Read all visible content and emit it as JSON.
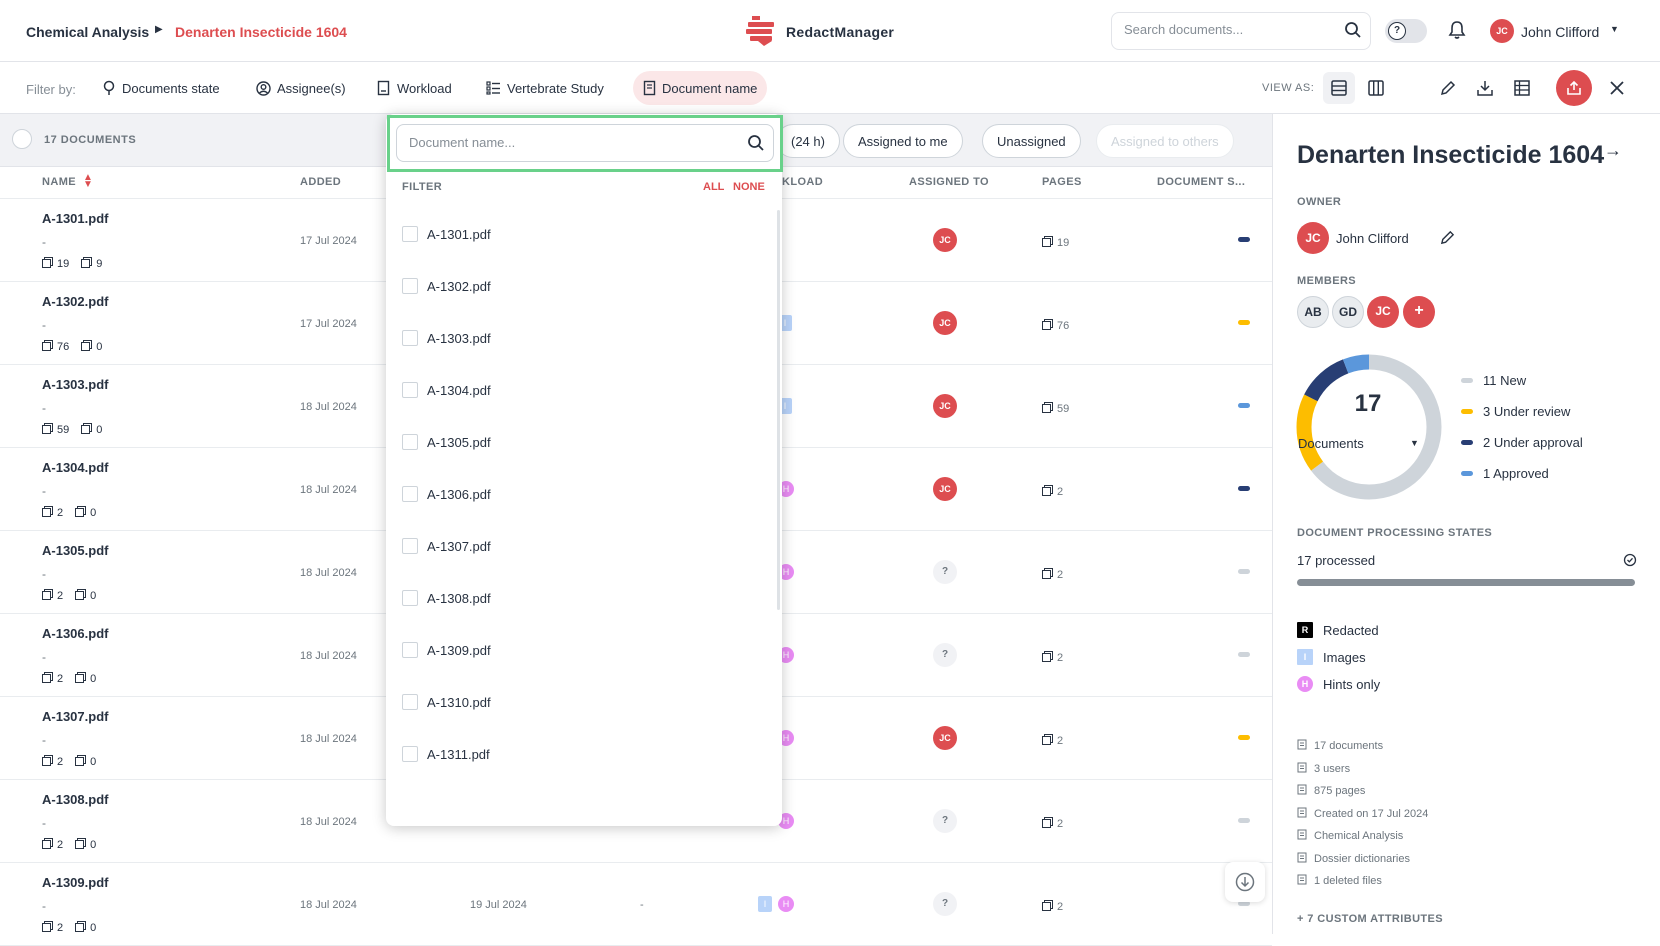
{
  "header": {
    "breadcrumb_root": "Chemical Analysis",
    "breadcrumb_current": "Denarten Insecticide 1604",
    "app_name": "RedactManager",
    "search_placeholder": "Search documents...",
    "help_label": "?",
    "user_initials": "JC",
    "user_name": "John Clifford"
  },
  "filters": {
    "label": "Filter by:",
    "items": [
      "Documents state",
      "Assignee(s)",
      "Workload",
      "Vertebrate Study",
      "Document name"
    ],
    "view_as": "VIEW AS:"
  },
  "table": {
    "count_label": "17 DOCUMENTS",
    "quick_filters": [
      "(24 h)",
      "Assigned to me",
      "Unassigned",
      "Assigned to others"
    ],
    "columns": [
      "NAME",
      "ADDED",
      "KLOAD",
      "ASSIGNED TO",
      "PAGES",
      "DOCUMENT S..."
    ],
    "rows": [
      {
        "name": "A-1301.pdf",
        "dash": "-",
        "pages_meta": "19",
        "annot_meta": "9",
        "added": "17 Jul 2024",
        "assignee": "JC",
        "pages": "19",
        "state_color": "#283e74",
        "workload": ""
      },
      {
        "name": "A-1302.pdf",
        "dash": "-",
        "pages_meta": "76",
        "annot_meta": "0",
        "added": "17 Jul 2024",
        "assignee": "JC",
        "pages": "76",
        "state_color": "#fdbd00",
        "workload": "I"
      },
      {
        "name": "A-1303.pdf",
        "dash": "-",
        "pages_meta": "59",
        "annot_meta": "0",
        "added": "18 Jul 2024",
        "assignee": "JC",
        "pages": "59",
        "state_color": "#5b97db",
        "workload": "I"
      },
      {
        "name": "A-1304.pdf",
        "dash": "-",
        "pages_meta": "2",
        "annot_meta": "0",
        "added": "18 Jul 2024",
        "assignee": "JC",
        "pages": "2",
        "state_color": "#283e74",
        "workload": "H"
      },
      {
        "name": "A-1305.pdf",
        "dash": "-",
        "pages_meta": "2",
        "annot_meta": "0",
        "added": "18 Jul 2024",
        "assignee": "?",
        "pages": "2",
        "state_color": "#ced4da",
        "workload": "H"
      },
      {
        "name": "A-1306.pdf",
        "dash": "-",
        "pages_meta": "2",
        "annot_meta": "0",
        "added": "18 Jul 2024",
        "assignee": "?",
        "pages": "2",
        "state_color": "#ced4da",
        "workload": "H"
      },
      {
        "name": "A-1307.pdf",
        "dash": "-",
        "pages_meta": "2",
        "annot_meta": "0",
        "added": "18 Jul 2024",
        "assignee": "JC",
        "pages": "2",
        "state_color": "#fdbd00",
        "workload": "H"
      },
      {
        "name": "A-1308.pdf",
        "dash": "-",
        "pages_meta": "2",
        "annot_meta": "0",
        "added": "18 Jul 2024",
        "assignee": "?",
        "pages": "2",
        "state_color": "#ced4da",
        "workload": "H"
      },
      {
        "name": "A-1309.pdf",
        "dash": "-",
        "pages_meta": "2",
        "annot_meta": "0",
        "added": "18 Jul 2024",
        "assignee": "?",
        "pages": "2",
        "state_color": "#ced4da",
        "workload": "IH",
        "last_processed": "19 Jul 2024",
        "extra_dash": "-"
      }
    ]
  },
  "dropdown": {
    "placeholder": "Document name...",
    "filter_label": "FILTER",
    "all_label": "ALL",
    "none_label": "NONE",
    "options": [
      "A-1301.pdf",
      "A-1302.pdf",
      "A-1303.pdf",
      "A-1304.pdf",
      "A-1305.pdf",
      "A-1306.pdf",
      "A-1307.pdf",
      "A-1308.pdf",
      "A-1309.pdf",
      "A-1310.pdf",
      "A-1311.pdf"
    ]
  },
  "panel": {
    "title": "Denarten Insecticide 1604",
    "owner_label": "OWNER",
    "owner_initials": "JC",
    "owner_name": "John Clifford",
    "members_label": "MEMBERS",
    "members": [
      "AB",
      "GD",
      "JC"
    ],
    "add_member": "+",
    "total": "17",
    "total_label": "Documents",
    "legend": [
      {
        "label": "11 New",
        "color": "#ced4da",
        "value": 11
      },
      {
        "label": "3 Under review",
        "color": "#fdbd00",
        "value": 3
      },
      {
        "label": "2 Under approval",
        "color": "#283e74",
        "value": 2
      },
      {
        "label": "1 Approved",
        "color": "#5b97db",
        "value": 1
      }
    ],
    "processing_label": "DOCUMENT PROCESSING STATES",
    "processed": "17 processed",
    "flags": [
      {
        "letter": "R",
        "label": "Redacted",
        "color": "#000000"
      },
      {
        "letter": "I",
        "label": "Images",
        "color": "#b8d3f9"
      },
      {
        "letter": "H",
        "label": "Hints only",
        "color": "#e98cf4"
      }
    ],
    "stats": [
      "17 documents",
      "3 users",
      "875 pages",
      "Created on 17 Jul 2024",
      "Chemical Analysis",
      "Dossier dictionaries",
      "1 deleted files"
    ],
    "custom_attrs": "+ 7 CUSTOM ATTRIBUTES"
  }
}
